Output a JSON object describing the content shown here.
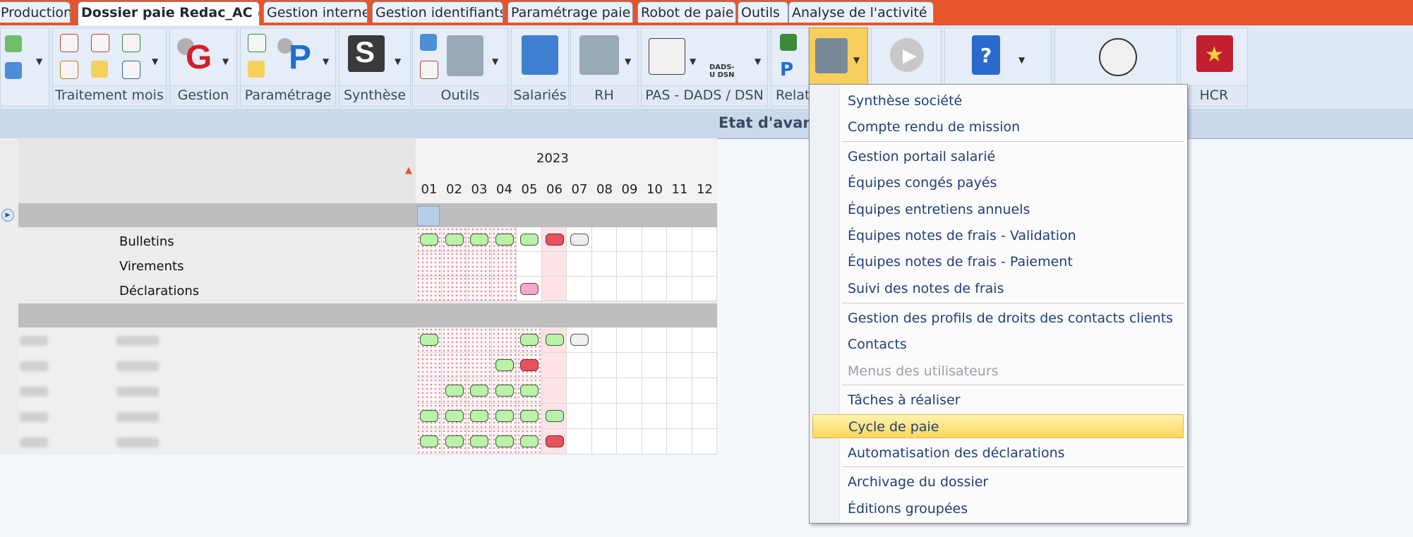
{
  "tabs": [
    {
      "label": "Production"
    },
    {
      "label": "Dossier paie Redac_AC"
    },
    {
      "label": "Gestion interne"
    },
    {
      "label": "Gestion identifiants"
    },
    {
      "label": "Paramétrage paie"
    },
    {
      "label": "Robot de paie"
    },
    {
      "label": "Outils"
    },
    {
      "label": "Analyse de l'activité"
    }
  ],
  "ribbon_groups": [
    {
      "label": "Traitement mois"
    },
    {
      "label": "Gestion"
    },
    {
      "label": "Paramétrage"
    },
    {
      "label": "Synthèse"
    },
    {
      "label": "Outils"
    },
    {
      "label": "Salariés"
    },
    {
      "label": "RH"
    },
    {
      "label": "PAS - DADS / DSN"
    },
    {
      "label": "Relat"
    },
    {
      "label": "HCR"
    }
  ],
  "ribbon_text": {
    "dads": "DADS-U DSN"
  },
  "title": "Etat d'avan",
  "grid": {
    "year": "2023",
    "months": [
      "01",
      "02",
      "03",
      "04",
      "05",
      "06",
      "07",
      "08",
      "09",
      "10",
      "11",
      "12"
    ],
    "rows": [
      {
        "label": "Bulletins"
      },
      {
        "label": "Virements"
      },
      {
        "label": "Déclarations"
      }
    ]
  },
  "menu": {
    "items": [
      {
        "label": "Synthèse société"
      },
      {
        "label": "Compte rendu de mission"
      },
      {
        "label": "Gestion portail salarié"
      },
      {
        "label": "Équipes congés payés"
      },
      {
        "label": "Équipes entretiens annuels"
      },
      {
        "label": "Équipes notes de frais - Validation"
      },
      {
        "label": "Équipes notes de frais - Paiement"
      },
      {
        "label": "Suivi des notes de frais"
      },
      {
        "label": "Gestion des profils de droits des contacts clients"
      },
      {
        "label": "Contacts"
      },
      {
        "label": "Menus des utilisateurs"
      },
      {
        "label": "Tâches à réaliser"
      },
      {
        "label": "Cycle de paie"
      },
      {
        "label": "Automatisation des déclarations"
      },
      {
        "label": "Archivage du dossier"
      },
      {
        "label": "Éditions groupées"
      }
    ]
  },
  "colors": {
    "tab_bar": "#e8542a",
    "ribbon": "#dfe9f5",
    "menu_highlight": "#fbd75a",
    "status_green": "#b9f2a8",
    "status_red": "#e8525f"
  }
}
